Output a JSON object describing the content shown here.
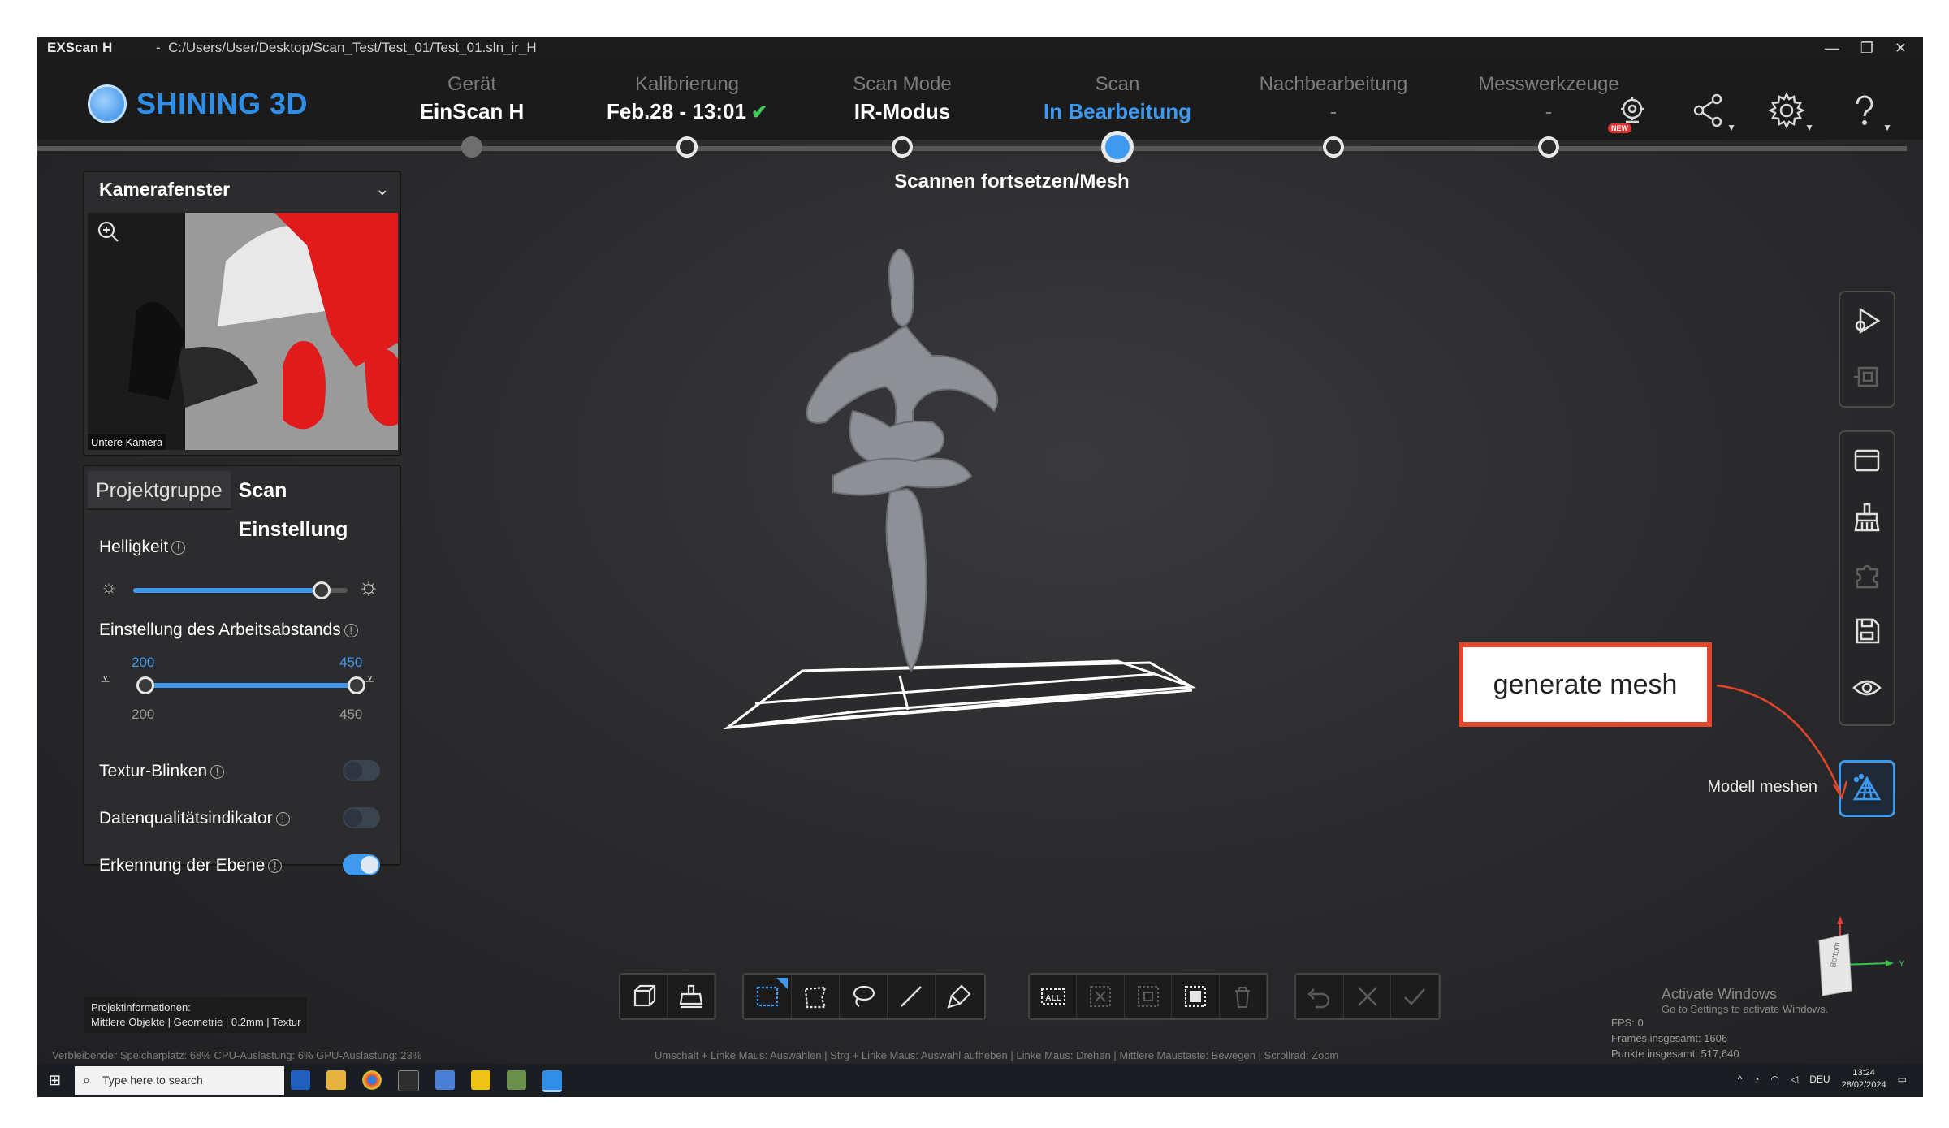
{
  "window": {
    "app_name": "EXScan H",
    "separator": "-",
    "path": "C:/Users/User/Desktop/Scan_Test/Test_01/Test_01.sln_ir_H",
    "controls": [
      "—",
      "❐",
      "✕"
    ]
  },
  "brand": {
    "name": "SHINING 3D",
    "color": "#2f8fe8"
  },
  "steps": [
    {
      "label": "Gerät",
      "value": "EinScan H",
      "state": "done"
    },
    {
      "label": "Kalibrierung",
      "value": "Feb.28 - 13:01",
      "check": "✔",
      "state": "done"
    },
    {
      "label": "Scan Mode",
      "value": "IR-Modus",
      "state": "done"
    },
    {
      "label": "Scan",
      "value": "In Bearbeitung",
      "state": "active",
      "sub": "Scannen fortsetzen/Mesh"
    },
    {
      "label": "Nachbearbeitung",
      "value": "-",
      "state": "pending"
    },
    {
      "label": "Messwerkzeuge",
      "value": "-",
      "state": "pending"
    }
  ],
  "header_icons": {
    "new_badge": "NEW",
    "items": [
      "new-feature-icon",
      "share-icon",
      "gear-icon",
      "help-icon"
    ]
  },
  "camera": {
    "title": "Kamerafenster",
    "label": "Untere Kamera"
  },
  "settings": {
    "tab_inactive": "Projektgruppe",
    "tab_active": "Scan Einstellung",
    "brightness_label": "Helligkeit",
    "brightness_level": 0.88,
    "distance_label": "Einstellung des Arbeitsabstands",
    "distance_min_sel": "200",
    "distance_max_sel": "450",
    "distance_min": "200",
    "distance_max": "450",
    "texture_blink": "Textur-Blinken",
    "texture_blink_on": false,
    "data_quality": "Datenqualitätsindikator",
    "data_quality_on": false,
    "plane_detection": "Erkennung der Ebene",
    "plane_detection_on": true
  },
  "annotation": {
    "text": "generate mesh",
    "color": "#e1462a"
  },
  "mesh_button_label": "Modell meshen",
  "project_info": {
    "title": "Projektinformationen:",
    "details": "Mittlere Objekte | Geometrie | 0.2mm | Textur"
  },
  "status": {
    "left": "Verbleibender Speicherplatz: 68%  CPU-Auslastung: 6%  GPU-Auslastung: 23%",
    "center": "Umschalt + Linke Maus: Auswählen | Strg + Linke Maus: Auswahl aufheben | Linke Maus: Drehen | Mittlere Maustaste: Bewegen | Scrollrad: Zoom",
    "fps": "FPS: 0",
    "frames": "Frames insgesamt: 1606",
    "points": "Punkte insgesamt: 517,640"
  },
  "activate_windows": {
    "title": "Activate Windows",
    "subtitle": "Go to Settings to activate Windows."
  },
  "cube_labels": {
    "face": "Bottom",
    "axis_x": "Y"
  },
  "taskbar": {
    "search_placeholder": "Type here to search",
    "language": "DEU",
    "time": "13:24",
    "date": "28/02/2024"
  }
}
